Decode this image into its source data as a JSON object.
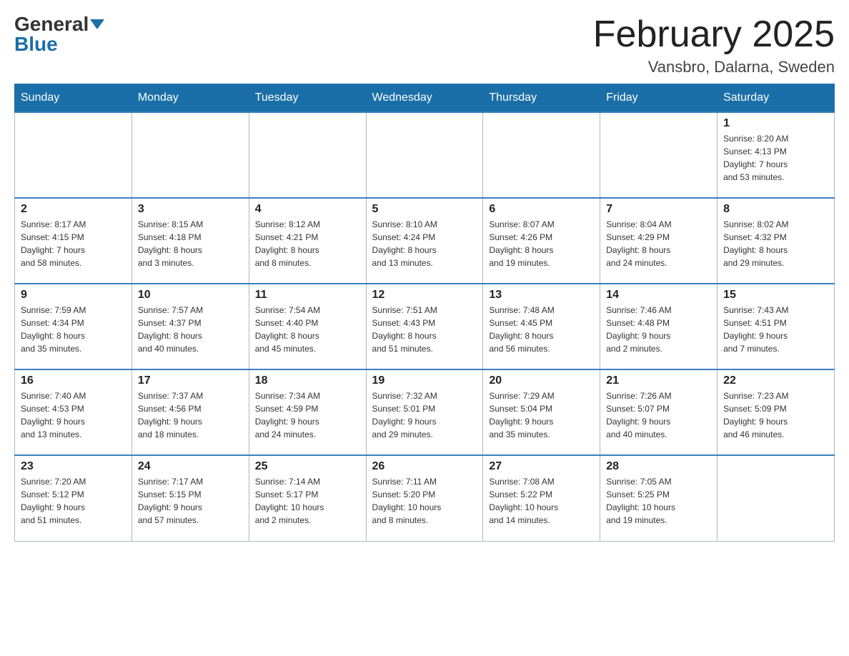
{
  "header": {
    "logo_general": "General",
    "logo_blue": "Blue",
    "month_title": "February 2025",
    "location": "Vansbro, Dalarna, Sweden"
  },
  "weekdays": [
    "Sunday",
    "Monday",
    "Tuesday",
    "Wednesday",
    "Thursday",
    "Friday",
    "Saturday"
  ],
  "weeks": [
    [
      {
        "day": "",
        "info": ""
      },
      {
        "day": "",
        "info": ""
      },
      {
        "day": "",
        "info": ""
      },
      {
        "day": "",
        "info": ""
      },
      {
        "day": "",
        "info": ""
      },
      {
        "day": "",
        "info": ""
      },
      {
        "day": "1",
        "info": "Sunrise: 8:20 AM\nSunset: 4:13 PM\nDaylight: 7 hours\nand 53 minutes."
      }
    ],
    [
      {
        "day": "2",
        "info": "Sunrise: 8:17 AM\nSunset: 4:15 PM\nDaylight: 7 hours\nand 58 minutes."
      },
      {
        "day": "3",
        "info": "Sunrise: 8:15 AM\nSunset: 4:18 PM\nDaylight: 8 hours\nand 3 minutes."
      },
      {
        "day": "4",
        "info": "Sunrise: 8:12 AM\nSunset: 4:21 PM\nDaylight: 8 hours\nand 8 minutes."
      },
      {
        "day": "5",
        "info": "Sunrise: 8:10 AM\nSunset: 4:24 PM\nDaylight: 8 hours\nand 13 minutes."
      },
      {
        "day": "6",
        "info": "Sunrise: 8:07 AM\nSunset: 4:26 PM\nDaylight: 8 hours\nand 19 minutes."
      },
      {
        "day": "7",
        "info": "Sunrise: 8:04 AM\nSunset: 4:29 PM\nDaylight: 8 hours\nand 24 minutes."
      },
      {
        "day": "8",
        "info": "Sunrise: 8:02 AM\nSunset: 4:32 PM\nDaylight: 8 hours\nand 29 minutes."
      }
    ],
    [
      {
        "day": "9",
        "info": "Sunrise: 7:59 AM\nSunset: 4:34 PM\nDaylight: 8 hours\nand 35 minutes."
      },
      {
        "day": "10",
        "info": "Sunrise: 7:57 AM\nSunset: 4:37 PM\nDaylight: 8 hours\nand 40 minutes."
      },
      {
        "day": "11",
        "info": "Sunrise: 7:54 AM\nSunset: 4:40 PM\nDaylight: 8 hours\nand 45 minutes."
      },
      {
        "day": "12",
        "info": "Sunrise: 7:51 AM\nSunset: 4:43 PM\nDaylight: 8 hours\nand 51 minutes."
      },
      {
        "day": "13",
        "info": "Sunrise: 7:48 AM\nSunset: 4:45 PM\nDaylight: 8 hours\nand 56 minutes."
      },
      {
        "day": "14",
        "info": "Sunrise: 7:46 AM\nSunset: 4:48 PM\nDaylight: 9 hours\nand 2 minutes."
      },
      {
        "day": "15",
        "info": "Sunrise: 7:43 AM\nSunset: 4:51 PM\nDaylight: 9 hours\nand 7 minutes."
      }
    ],
    [
      {
        "day": "16",
        "info": "Sunrise: 7:40 AM\nSunset: 4:53 PM\nDaylight: 9 hours\nand 13 minutes."
      },
      {
        "day": "17",
        "info": "Sunrise: 7:37 AM\nSunset: 4:56 PM\nDaylight: 9 hours\nand 18 minutes."
      },
      {
        "day": "18",
        "info": "Sunrise: 7:34 AM\nSunset: 4:59 PM\nDaylight: 9 hours\nand 24 minutes."
      },
      {
        "day": "19",
        "info": "Sunrise: 7:32 AM\nSunset: 5:01 PM\nDaylight: 9 hours\nand 29 minutes."
      },
      {
        "day": "20",
        "info": "Sunrise: 7:29 AM\nSunset: 5:04 PM\nDaylight: 9 hours\nand 35 minutes."
      },
      {
        "day": "21",
        "info": "Sunrise: 7:26 AM\nSunset: 5:07 PM\nDaylight: 9 hours\nand 40 minutes."
      },
      {
        "day": "22",
        "info": "Sunrise: 7:23 AM\nSunset: 5:09 PM\nDaylight: 9 hours\nand 46 minutes."
      }
    ],
    [
      {
        "day": "23",
        "info": "Sunrise: 7:20 AM\nSunset: 5:12 PM\nDaylight: 9 hours\nand 51 minutes."
      },
      {
        "day": "24",
        "info": "Sunrise: 7:17 AM\nSunset: 5:15 PM\nDaylight: 9 hours\nand 57 minutes."
      },
      {
        "day": "25",
        "info": "Sunrise: 7:14 AM\nSunset: 5:17 PM\nDaylight: 10 hours\nand 2 minutes."
      },
      {
        "day": "26",
        "info": "Sunrise: 7:11 AM\nSunset: 5:20 PM\nDaylight: 10 hours\nand 8 minutes."
      },
      {
        "day": "27",
        "info": "Sunrise: 7:08 AM\nSunset: 5:22 PM\nDaylight: 10 hours\nand 14 minutes."
      },
      {
        "day": "28",
        "info": "Sunrise: 7:05 AM\nSunset: 5:25 PM\nDaylight: 10 hours\nand 19 minutes."
      },
      {
        "day": "",
        "info": ""
      }
    ]
  ]
}
